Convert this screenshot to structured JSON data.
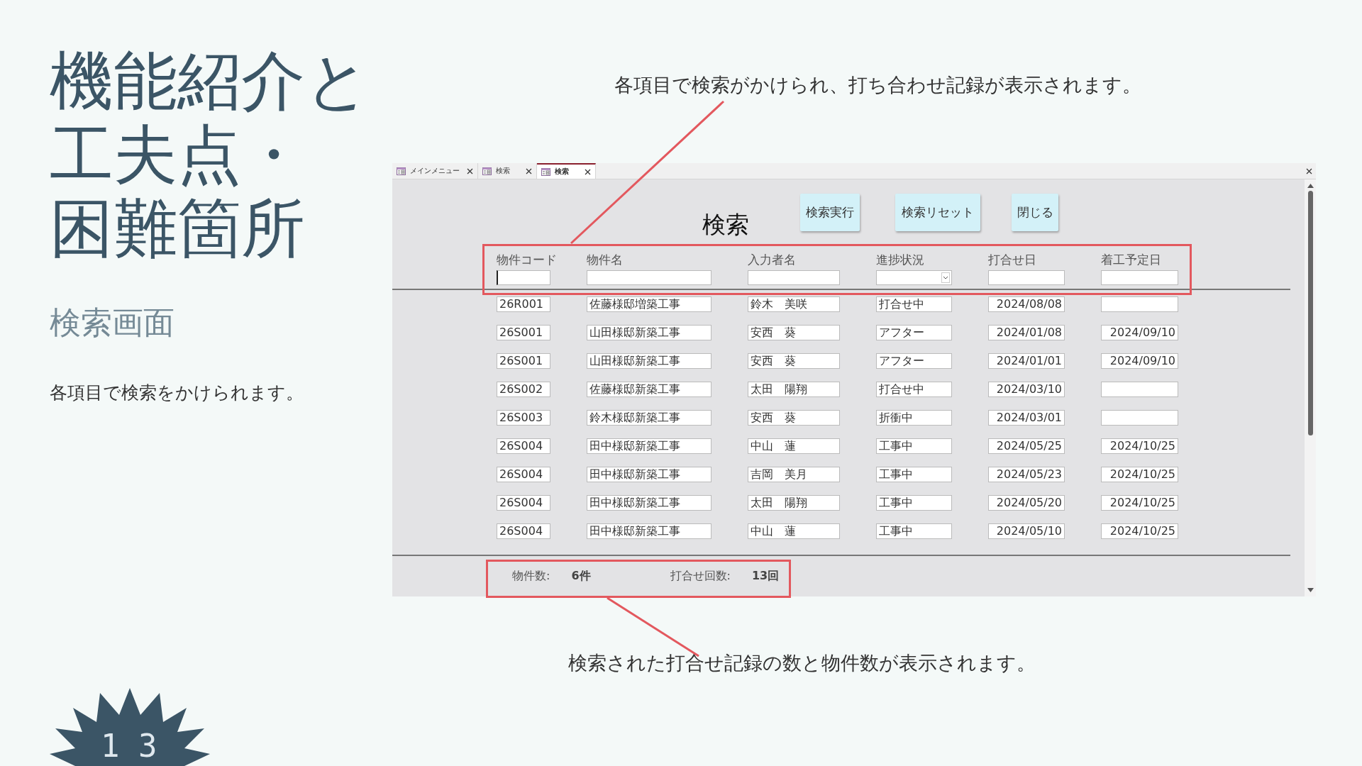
{
  "slide": {
    "title_lines": [
      "機能紹介と",
      "工夫点・",
      "困難箇所"
    ],
    "subtitle": "検索画面",
    "description": "各項目で検索をかけられます。",
    "page_number": "1 3"
  },
  "callouts": [
    {
      "text": "各項目で検索がかけられ、打ち合わせ記録が表示されます。"
    },
    {
      "text": "検索された打合せ記録の数と物件数が表示されます。"
    }
  ],
  "app": {
    "tabs": [
      {
        "label": "メインメニュー",
        "selected": false
      },
      {
        "label": "検索",
        "selected": false
      },
      {
        "label": "検索",
        "selected": true
      }
    ],
    "form_title": "検索",
    "buttons": [
      "検索実行",
      "検索リセット",
      "閉じる"
    ],
    "filters": [
      {
        "label": "物件コード",
        "kind": "text"
      },
      {
        "label": "物件名",
        "kind": "text"
      },
      {
        "label": "入力者名",
        "kind": "text"
      },
      {
        "label": "進捗状況",
        "kind": "dropdown"
      },
      {
        "label": "打合せ日",
        "kind": "text"
      },
      {
        "label": "着工予定日",
        "kind": "text"
      }
    ],
    "rows": [
      {
        "code": "26R001",
        "name": "佐藤様邸増築工事",
        "person": "鈴木　美咲",
        "status": "打合せ中",
        "meeting_date": "2024/08/08"
      },
      {
        "code": "26S001",
        "name": "山田様邸新築工事",
        "person": "安西　葵",
        "status": "アフター",
        "meeting_date": "2024/01/08",
        "start_date": "2024/09/10"
      },
      {
        "code": "26S001",
        "name": "山田様邸新築工事",
        "person": "安西　葵",
        "status": "アフター",
        "meeting_date": "2024/01/01",
        "start_date": "2024/09/10"
      },
      {
        "code": "26S002",
        "name": "佐藤様邸新築工事",
        "person": "太田　陽翔",
        "status": "打合せ中",
        "meeting_date": "2024/03/10"
      },
      {
        "code": "26S003",
        "name": "鈴木様邸新築工事",
        "person": "安西　葵",
        "status": "折衝中",
        "meeting_date": "2024/03/01"
      },
      {
        "code": "26S004",
        "name": "田中様邸新築工事",
        "person": "中山　蓮",
        "status": "工事中",
        "meeting_date": "2024/05/25",
        "start_date": "2024/10/25"
      },
      {
        "code": "26S004",
        "name": "田中様邸新築工事",
        "person": "吉岡　美月",
        "status": "工事中",
        "meeting_date": "2024/05/23",
        "start_date": "2024/10/25"
      },
      {
        "code": "26S004",
        "name": "田中様邸新築工事",
        "person": "太田　陽翔",
        "status": "工事中",
        "meeting_date": "2024/05/20",
        "start_date": "2024/10/25"
      },
      {
        "code": "26S004",
        "name": "田中様邸新築工事",
        "person": "中山　蓮",
        "status": "工事中",
        "meeting_date": "2024/05/10",
        "start_date": "2024/10/25"
      }
    ],
    "summary": [
      {
        "label": "物件数:",
        "value": "6件"
      },
      {
        "label": "打合せ回数:",
        "value": "13回"
      }
    ]
  }
}
